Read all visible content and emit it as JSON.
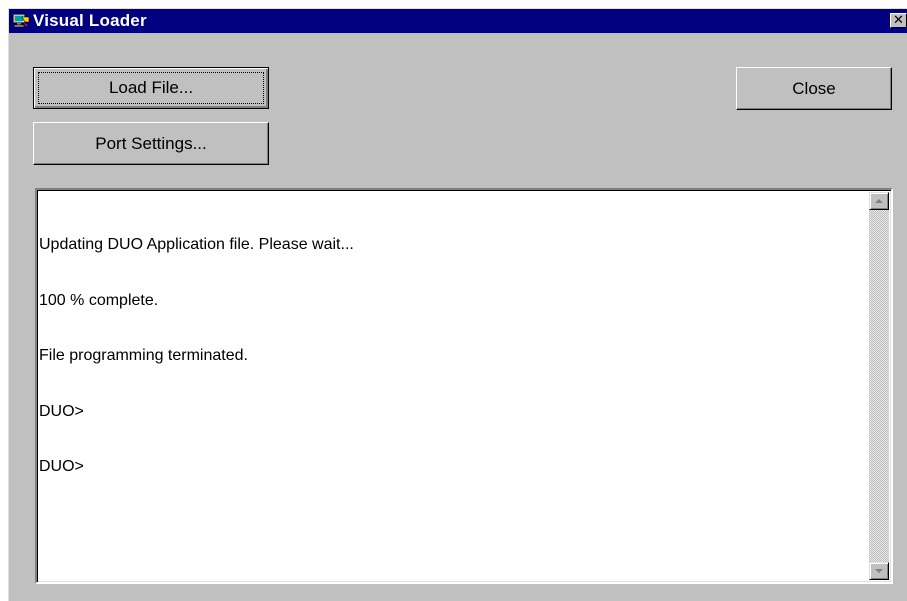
{
  "window": {
    "title": "Visual Loader",
    "close_glyph": "✕",
    "icon": "visual-loader-app-icon"
  },
  "buttons": {
    "load_file": "Load File...",
    "port_settings": "Port Settings...",
    "close": "Close"
  },
  "log": {
    "lines": [
      "Updating DUO Application file. Please wait...",
      "100 % complete.",
      "File programming terminated.",
      "DUO>",
      "DUO>"
    ]
  },
  "colors": {
    "titlebar": "#000080",
    "face": "#c0c0c0",
    "log_background": "#ffffff"
  }
}
